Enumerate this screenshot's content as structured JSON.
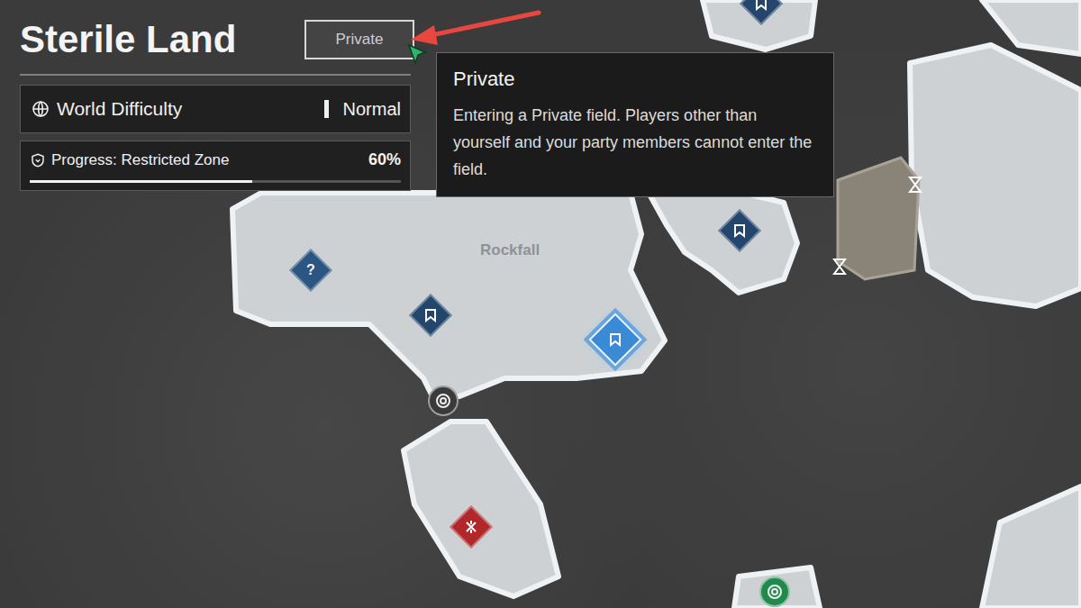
{
  "map": {
    "title": "Sterile Land",
    "labels": [
      {
        "text": "Rockfall"
      }
    ]
  },
  "visibility_button": {
    "label": "Private",
    "hovered": true
  },
  "tooltip": {
    "title": "Private",
    "body": "Entering a Private field. Players other than yourself and your party members cannot enter the field."
  },
  "world_difficulty": {
    "label": "World Difficulty",
    "value": "Normal"
  },
  "progress": {
    "label": "Progress: Restricted Zone",
    "value": "60%",
    "level": 0.6
  },
  "pins": [
    {
      "kind": "mystery",
      "text": "?",
      "selected": false,
      "color": "#2b5582"
    },
    {
      "kind": "quest",
      "selected": false,
      "color": "#24466d"
    },
    {
      "kind": "quest",
      "selected": true,
      "color": "#3b8ad6"
    },
    {
      "kind": "quest",
      "selected": false,
      "color": "#24466d"
    },
    {
      "kind": "quest",
      "selected": false,
      "color": "#24466d"
    },
    {
      "kind": "outpost",
      "selected": false,
      "color": "#3a3a3a"
    },
    {
      "kind": "boss",
      "selected": false,
      "color": "#b0282a"
    },
    {
      "kind": "vendor",
      "selected": false,
      "color": "#1f8a4c"
    },
    {
      "kind": "gate",
      "selected": false,
      "color": "#ffffff"
    },
    {
      "kind": "gate",
      "selected": false,
      "color": "#ffffff"
    }
  ]
}
